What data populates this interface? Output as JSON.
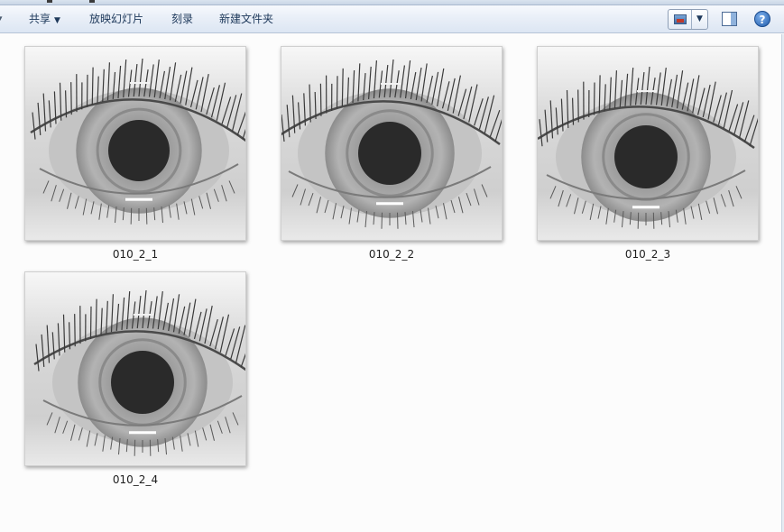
{
  "toolbar": {
    "share_label": "共享",
    "slideshow_label": "放映幻灯片",
    "burn_label": "刻录",
    "new_folder_label": "新建文件夹",
    "icons": {
      "view": "picture-view-icon",
      "view_dropdown": "chevron-down-icon",
      "preview": "preview-pane-icon",
      "help": "help-icon"
    }
  },
  "files": [
    {
      "name": "010_2_1"
    },
    {
      "name": "010_2_2"
    },
    {
      "name": "010_2_3"
    },
    {
      "name": "010_2_4"
    }
  ],
  "colors": {
    "toolbar_text": "#1e395b",
    "help_blue": "#1f5aa8",
    "pupil": "#2a2a2a"
  }
}
